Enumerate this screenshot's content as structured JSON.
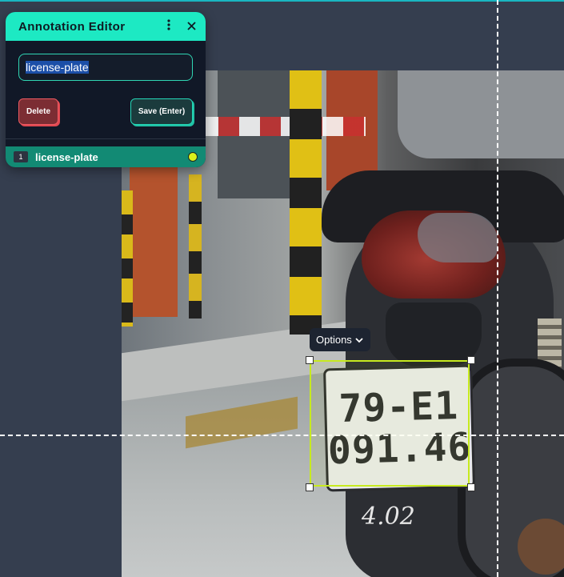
{
  "editor": {
    "title": "Annotation Editor",
    "menu_icon": "more-vertical-icon",
    "close_icon": "close-icon",
    "label_value": "license-plate",
    "delete_label": "Delete",
    "save_label": "Save (Enter)",
    "annotations": [
      {
        "index": "1",
        "label": "license-plate",
        "color": "#d9f21b"
      }
    ]
  },
  "canvas": {
    "options_label": "Options",
    "options_icon": "chevron-down-icon",
    "box_color": "#c7ea1f",
    "plate_line1": "79-E1",
    "plate_line2": "091.46",
    "handwriting": "4.02"
  },
  "colors": {
    "accent": "#1de9c3",
    "background": "#353e4f",
    "danger": "#ef5a62"
  }
}
